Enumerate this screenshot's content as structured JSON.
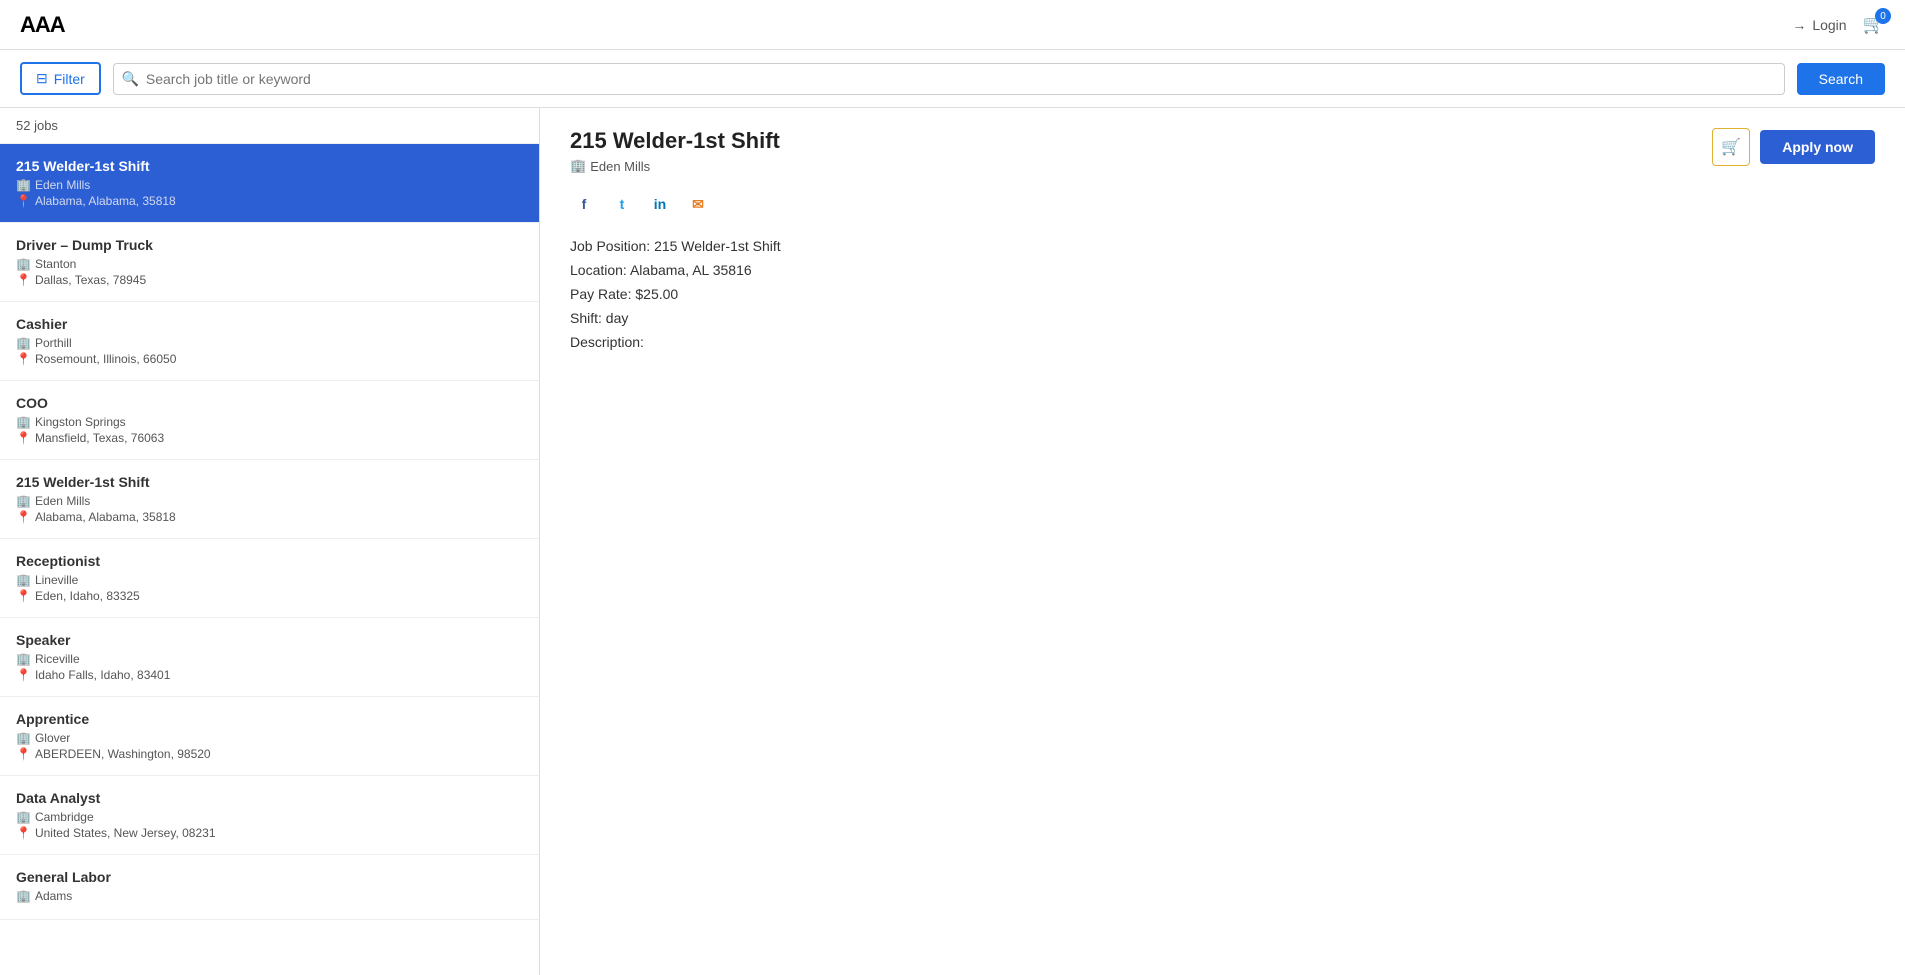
{
  "header": {
    "logo": "AAA",
    "login_label": "Login",
    "cart_count": "0"
  },
  "search": {
    "filter_label": "Filter",
    "placeholder": "Search job title or keyword",
    "search_label": "Search"
  },
  "jobs_count": "52 jobs",
  "jobs": [
    {
      "id": 1,
      "title": "215 Welder-1st Shift",
      "company": "Eden Mills",
      "location": "Alabama, Alabama, 35818",
      "active": true
    },
    {
      "id": 2,
      "title": "Driver – Dump Truck",
      "company": "Stanton",
      "location": "Dallas, Texas, 78945",
      "active": false
    },
    {
      "id": 3,
      "title": "Cashier",
      "company": "Porthill",
      "location": "Rosemount, Illinois, 66050",
      "active": false
    },
    {
      "id": 4,
      "title": "COO",
      "company": "Kingston Springs",
      "location": "Mansfield, Texas, 76063",
      "active": false
    },
    {
      "id": 5,
      "title": "215 Welder-1st Shift",
      "company": "Eden Mills",
      "location": "Alabama, Alabama, 35818",
      "active": false
    },
    {
      "id": 6,
      "title": "Receptionist",
      "company": "Lineville",
      "location": "Eden, Idaho, 83325",
      "active": false
    },
    {
      "id": 7,
      "title": "Speaker",
      "company": "Riceville",
      "location": "Idaho Falls, Idaho, 83401",
      "active": false
    },
    {
      "id": 8,
      "title": "Apprentice",
      "company": "Glover",
      "location": "ABERDEEN, Washington, 98520",
      "active": false
    },
    {
      "id": 9,
      "title": "Data Analyst",
      "company": "Cambridge",
      "location": "United States, New Jersey, 08231",
      "active": false
    },
    {
      "id": 10,
      "title": "General Labor",
      "company": "Adams",
      "location": "",
      "active": false
    }
  ],
  "detail": {
    "title": "215 Welder-1st Shift",
    "company": "Eden Mills",
    "apply_label": "Apply now",
    "job_position_label": "Job Position:",
    "job_position_value": "215 Welder-1st Shift",
    "location_label": "Location:",
    "location_value": "Alabama, AL 35816",
    "pay_rate_label": "Pay Rate:",
    "pay_rate_value": "$25.00",
    "shift_label": "Shift:",
    "shift_value": "day",
    "description_label": "Description:"
  }
}
